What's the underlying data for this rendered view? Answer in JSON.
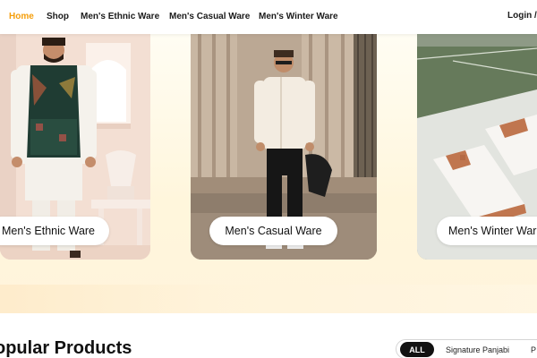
{
  "nav": {
    "home": "Home",
    "shop": "Shop",
    "ethnic": "Men's Ethnic Ware",
    "casual": "Men's Casual Ware",
    "winter": "Men's Winter Ware",
    "login": "Login /"
  },
  "categories": [
    {
      "label": "Men's Ethnic Ware"
    },
    {
      "label": "Men's Casual Ware"
    },
    {
      "label": "Men's Winter Ware"
    }
  ],
  "popular": {
    "title": "opular Products",
    "filters": [
      "ALL",
      "Signature Panjabi",
      "P"
    ]
  },
  "colors": {
    "accent": "#f59e0b",
    "active_filter_bg": "#111111",
    "pill_bg": "#ffffff"
  }
}
